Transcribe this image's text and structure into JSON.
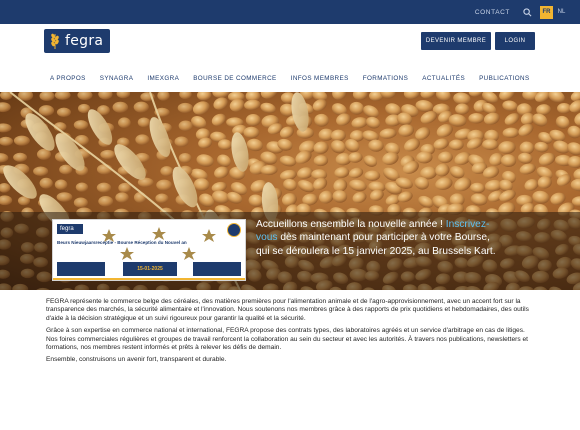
{
  "topbar": {
    "contact_label": "CONTACT",
    "search_icon": "search-icon",
    "languages": [
      "FR",
      "NL"
    ],
    "active_language": "FR",
    "bar_color": "#1e3b6d",
    "accent_color": "#f2b531"
  },
  "header": {
    "logo_text": "fegra",
    "logo_icon": "wheat-logo-icon",
    "become_member_label": "DEVENIR MEMBRE",
    "login_label": "LOGIN"
  },
  "nav": {
    "items": [
      "A PROPOS",
      "SYNAGRA",
      "IMEXGRA",
      "BOURSE DE COMMERCE",
      "INFOS MEMBRES",
      "FORMATIONS",
      "ACTUALITÉS",
      "PUBLICATIONS"
    ]
  },
  "hero": {
    "banner": {
      "logo_text": "fegra",
      "title": "Beurs Nieuwjaarsreceptie - Bourse Réception du Nouvel an",
      "date": "15-01-2025"
    },
    "text_before": "Accueillons ensemble la nouvelle année !",
    "link_text": "Inscrivez-vous",
    "text_after": "dès maintenant pour participer à votre Bourse, qui se déroulera le 15 janvier 2025, au Brussels Kart."
  },
  "intro": {
    "paragraphs": [
      "FEGRA représente le commerce belge des céréales, des matières premières pour l'alimentation animale et de l'agro-approvisionnement, avec un accent fort sur la transparence des marchés, la sécurité alimentaire et l'innovation. Nous soutenons nos membres grâce à des rapports de prix quotidiens et hebdomadaires, des outils d'aide à la décision stratégique et un suivi rigoureux pour garantir la qualité et la sécurité.",
      "Grâce à son expertise en commerce national et international, FEGRA propose des contrats types, des laboratoires agréés et un service d'arbitrage en cas de litiges. Nos foires commerciales régulières et groupes de travail renforcent la collaboration au sein du secteur et avec les autorités. À travers nos publications, newsletters et formations, nos membres restent informés et prêts à relever les défis de demain.",
      "Ensemble, construisons un avenir fort, transparent et durable."
    ]
  }
}
